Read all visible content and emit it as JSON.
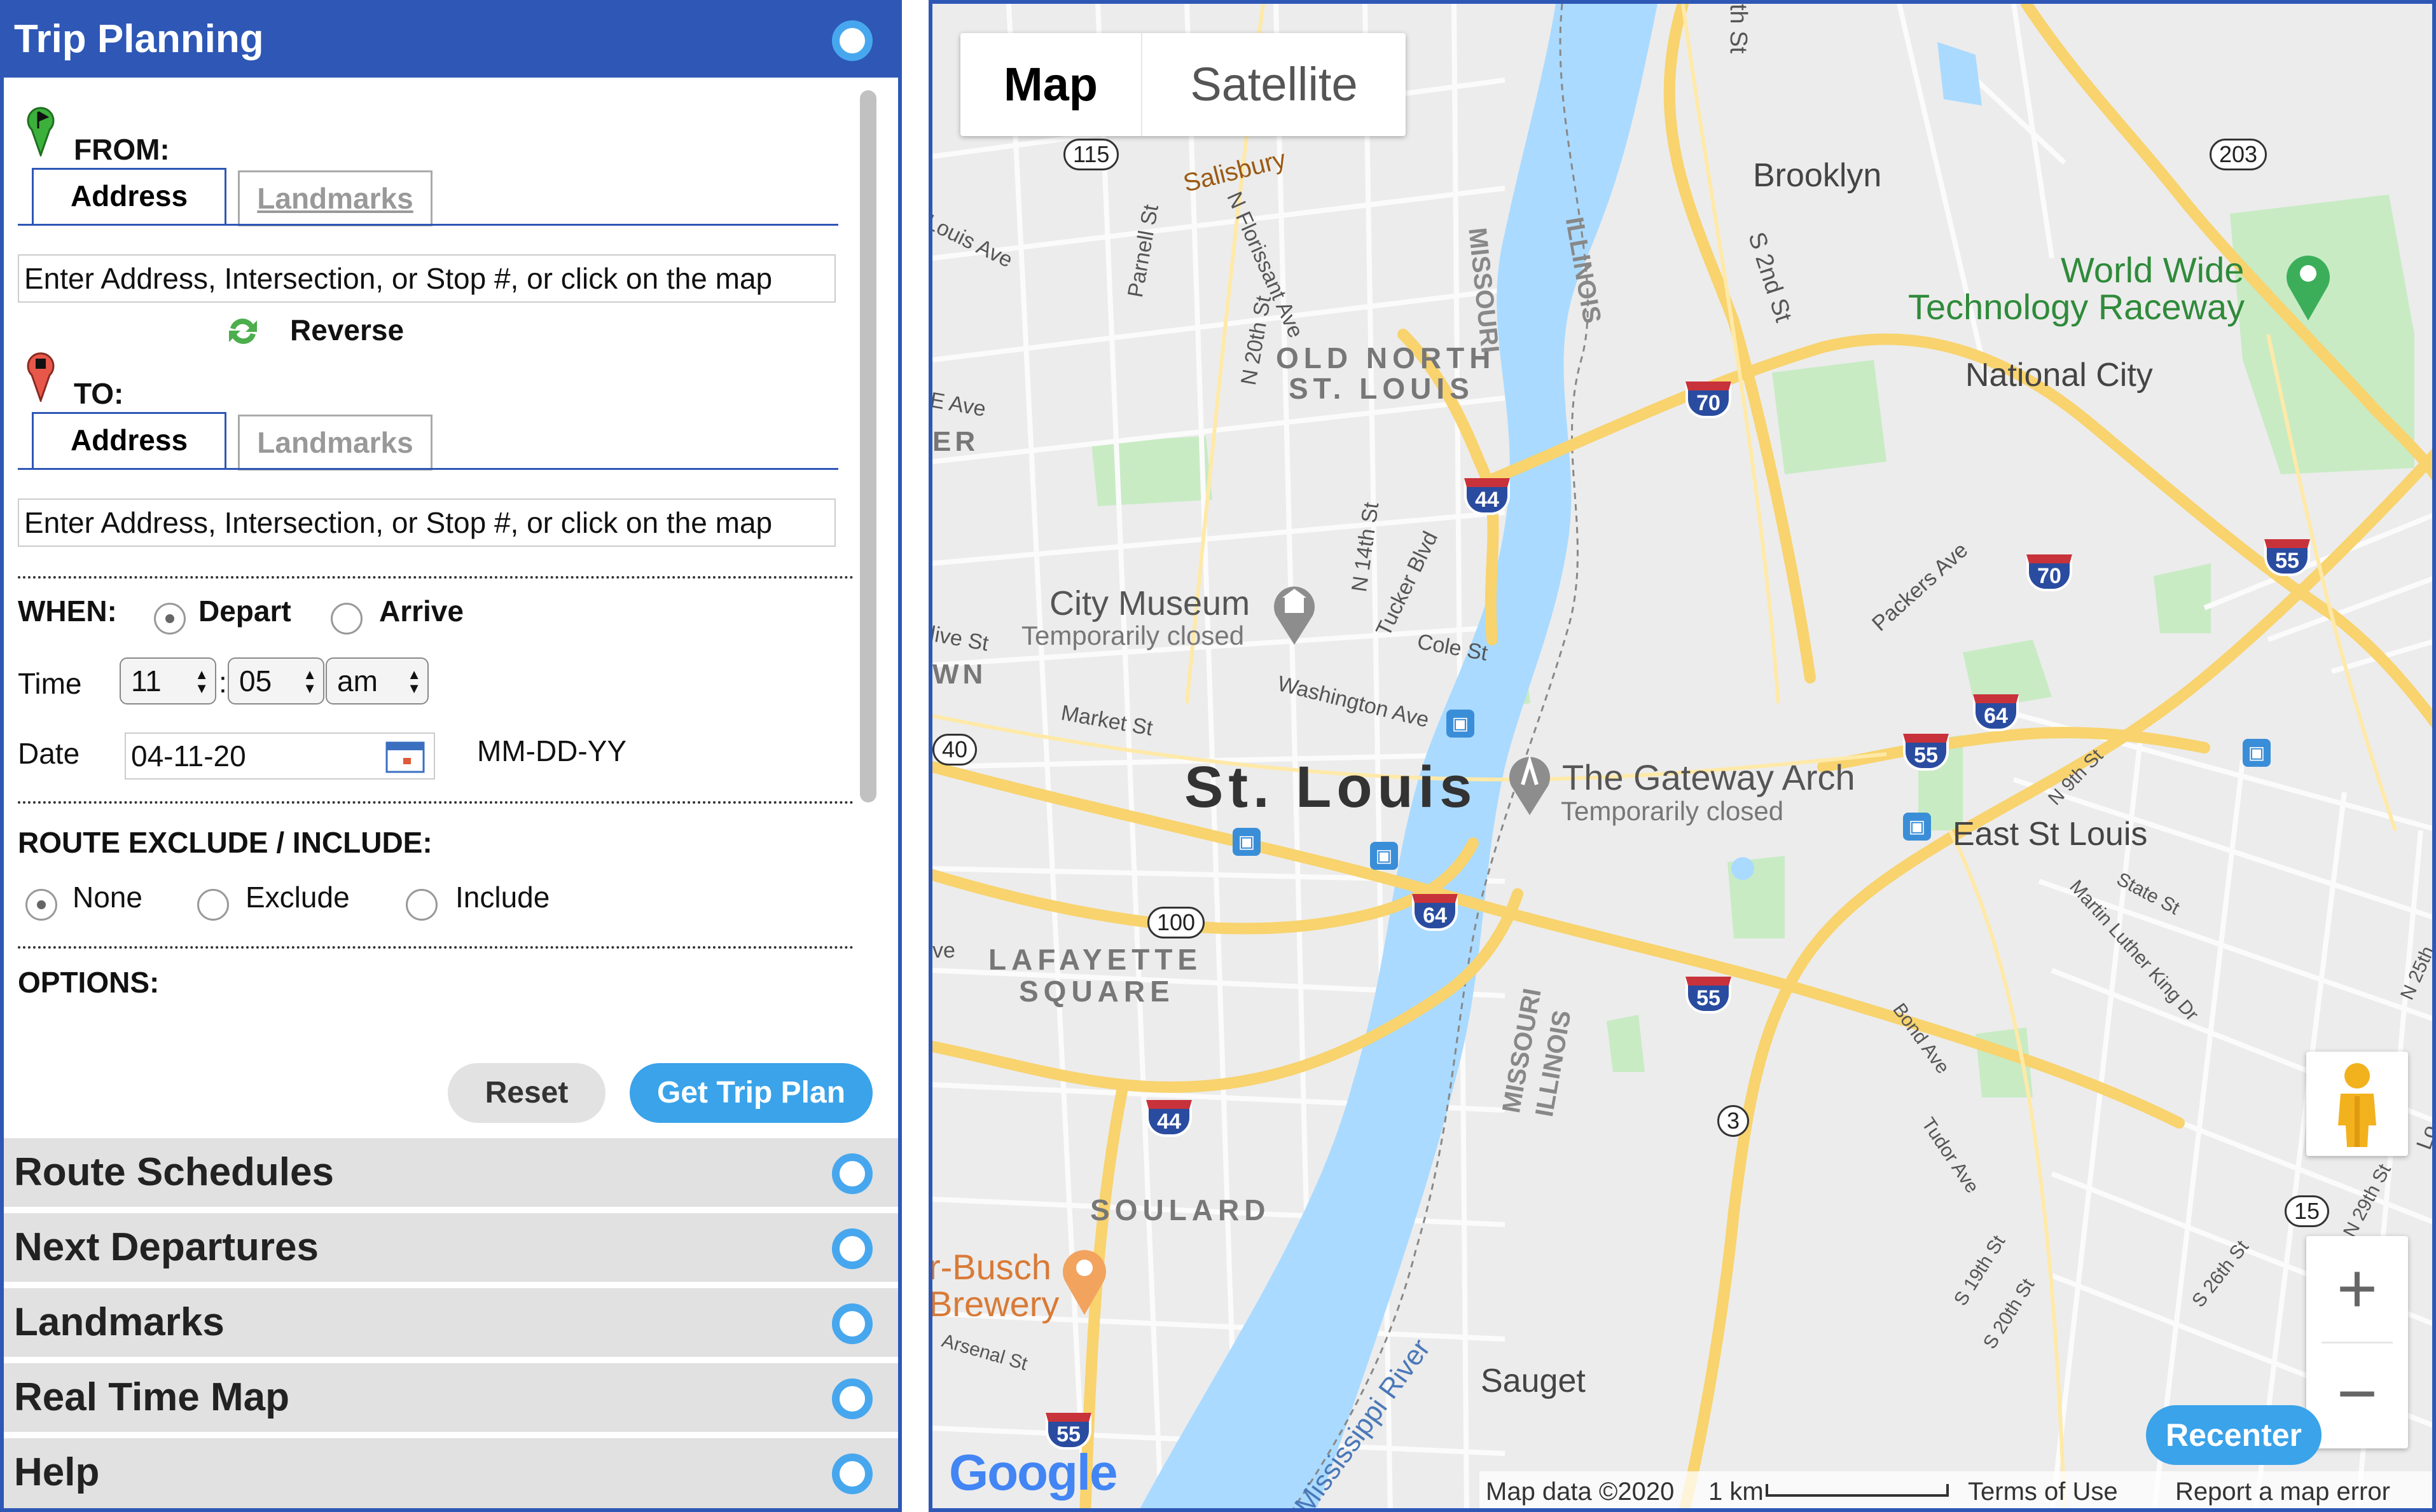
{
  "trip_planning": {
    "title": "Trip Planning",
    "from_label": "FROM:",
    "to_label": "TO:",
    "tabs": [
      "Address",
      "Landmarks"
    ],
    "from_placeholder": "Enter Address, Intersection, or Stop #, or click on the map",
    "to_placeholder": "Enter Address, Intersection, or Stop #, or click on the map",
    "reverse_label": "Reverse",
    "when_label": "WHEN:",
    "when_options": [
      "Depart",
      "Arrive"
    ],
    "when_selected": "Depart",
    "time_label": "Time",
    "time_hour": "11",
    "time_sep": ":",
    "time_minute": "05",
    "time_ampm": "am",
    "date_label": "Date",
    "date_value": "04-11-20",
    "date_format": "MM-DD-YY",
    "route_label": "ROUTE EXCLUDE / INCLUDE:",
    "route_options": [
      "None",
      "Exclude",
      "Include"
    ],
    "route_selected": "None",
    "options_label": "OPTIONS:",
    "reset_label": "Reset",
    "get_plan_label": "Get Trip Plan"
  },
  "accordion": [
    "Route Schedules",
    "Next Departures",
    "Landmarks",
    "Real Time Map",
    "Help"
  ],
  "map": {
    "type_map": "Map",
    "type_satellite": "Satellite",
    "labels": {
      "st_louis": "St. Louis",
      "east_st_louis": "East St Louis",
      "brooklyn": "Brooklyn",
      "national_city": "National City",
      "sauget": "Sauget",
      "old_north_1": "OLD NORTH",
      "old_north_2": "ST. LOUIS",
      "lafayette_1": "LAFAYETTE",
      "lafayette_2": "SQUARE",
      "soulard": "SOULARD",
      "missouri_1": "MISSOURI",
      "illinois_1": "ILLINOIS",
      "missouri_2": "MISSOURI",
      "illinois_2": "ILLINOIS",
      "mississippi": "Mississippi River",
      "city_museum": "City Museum",
      "city_museum_status": "Temporarily closed",
      "arch": "The Gateway Arch",
      "arch_status": "Temporarily closed",
      "wwt_1": "World Wide",
      "wwt_2": "Technology Raceway",
      "busch_1": "r-Busch",
      "busch_2": "Brewery",
      "salisbury": "Salisbury",
      "louis_ave": "Louis Ave",
      "parnell": "Parnell St",
      "n_florissant": "N Florissant Ave",
      "n_20th": "N 20th St",
      "n_14th": "N 14th St",
      "tucker": "Tucker Blvd",
      "cole": "Cole St",
      "washington": "Washington Ave",
      "market": "Market St",
      "packers": "Packers Ave",
      "s_2nd": "S 2nd St",
      "th_st": "th St",
      "n_9th": "N 9th St",
      "state": "State St",
      "mlk": "Martin Luther King Dr",
      "bond": "Bond Ave",
      "tudor": "Tudor Ave",
      "s_19th": "S 19th St",
      "s_20th": "S 20th St",
      "s_26th": "S 26th St",
      "n_29th": "N 29th St",
      "n_25th": "N 25th",
      "arsenal": "Arsenal St",
      "e_ave": "E Ave",
      "er": "ER",
      "wn": "WN",
      "live_st": "live St",
      "ve": "ve",
      "lo": "Lo"
    },
    "shields": {
      "i70a": "70",
      "i70b": "70",
      "i44a": "44",
      "i44b": "44",
      "i55a": "55",
      "i55b": "55",
      "i55c": "55",
      "i55d": "55",
      "i64a": "64",
      "i64b": "64"
    },
    "routes": {
      "r115": "115",
      "r203": "203",
      "r40": "40",
      "r100": "100",
      "r3": "3",
      "r15": "15"
    },
    "recenter": "Recenter",
    "attribution": "Map data ©2020",
    "scale": "1 km",
    "terms": "Terms of Use",
    "report": "Report a map error",
    "google": "Google",
    "colors": {
      "water": "#aadaff",
      "highway": "#f8d36e",
      "park": "#c8ebc4"
    }
  }
}
